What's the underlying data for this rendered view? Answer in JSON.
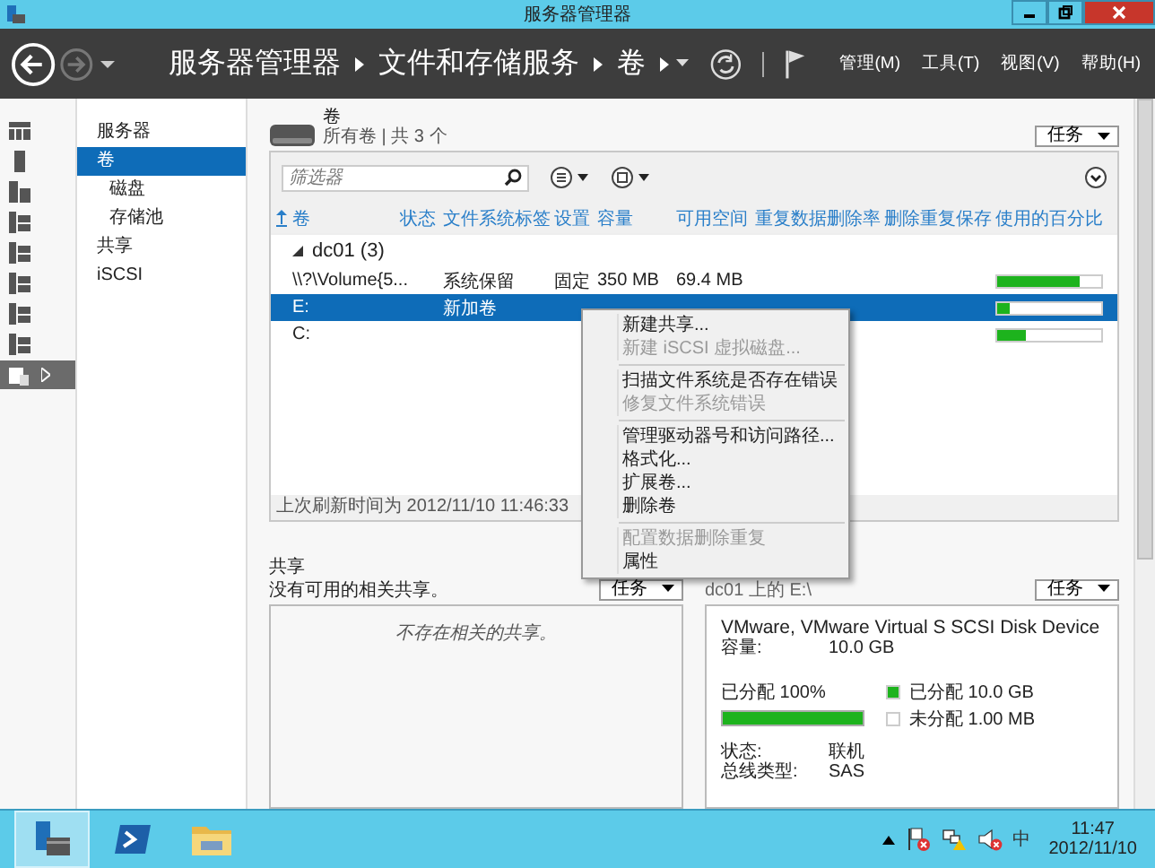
{
  "window": {
    "title": "服务器管理器"
  },
  "nav": {
    "breadcrumb": [
      "服务器管理器",
      "文件和存储服务",
      "卷"
    ],
    "menus": [
      "管理(M)",
      "工具(T)",
      "视图(V)",
      "帮助(H)"
    ]
  },
  "icon_bar": {
    "items": [
      {
        "selected": false
      },
      {
        "selected": false
      },
      {
        "selected": false
      },
      {
        "selected": false
      },
      {
        "selected": false
      },
      {
        "selected": false
      },
      {
        "selected": false
      },
      {
        "selected": false
      },
      {
        "selected": true
      }
    ]
  },
  "sidebar": {
    "items": [
      {
        "label": "服务器",
        "selected": false
      },
      {
        "label": "卷",
        "selected": true,
        "children": [
          {
            "label": "磁盘",
            "selected": false
          },
          {
            "label": "存储池",
            "selected": false
          }
        ]
      },
      {
        "label": "共享",
        "selected": false
      },
      {
        "label": "iSCSI",
        "selected": false
      }
    ]
  },
  "volumes": {
    "title": "卷",
    "subtitle": "所有卷 | 共 3 个",
    "tasks": "任务",
    "filter": {
      "placeholder": "筛选器"
    },
    "columns": [
      "卷",
      "状态",
      "文件系统标签",
      "设置",
      "容量",
      "可用空间",
      "重复数据删除率",
      "删除重复保存",
      "使用的百分比"
    ],
    "group": "dc01 (3)",
    "rows": [
      {
        "name": "\\\\?\\Volume{5...",
        "label": "系统保留",
        "setting": "固定",
        "capacity": "350 MB",
        "free": "69.4 MB",
        "level": 0.8,
        "selected": false
      },
      {
        "name": "E:",
        "label": "新加卷",
        "level": 0.12,
        "selected": true
      },
      {
        "name": "C:",
        "level": 0.28,
        "selected": false
      }
    ],
    "status": "上次刷新时间为 2012/11/10 11:46:33"
  },
  "context_menu": {
    "groups": [
      [
        {
          "label": "新建共享...",
          "disabled": false
        },
        {
          "label": "新建 iSCSI 虚拟磁盘...",
          "disabled": true
        }
      ],
      [
        {
          "label": "扫描文件系统是否存在错误",
          "disabled": false
        },
        {
          "label": "修复文件系统错误",
          "disabled": true
        }
      ],
      [
        {
          "label": "管理驱动器号和访问路径...",
          "disabled": false
        },
        {
          "label": "格式化...",
          "disabled": false
        },
        {
          "label": "扩展卷...",
          "disabled": false
        },
        {
          "label": "删除卷",
          "disabled": false
        }
      ],
      [
        {
          "label": "配置数据删除重复",
          "disabled": true
        },
        {
          "label": "属性",
          "disabled": false
        }
      ]
    ]
  },
  "shares": {
    "title": "共享",
    "subtitle": "没有可用的相关共享。",
    "tasks": "任务",
    "empty": "不存在相关的共享。"
  },
  "disk": {
    "heading": "dc01 上的 E:\\",
    "tasks": "任务",
    "name": "VMware, VMware Virtual S SCSI Disk Device",
    "capacity": {
      "label": "容量:",
      "value": "10.0 GB"
    },
    "allocated_label": "已分配 100%",
    "level": 1,
    "legend": [
      {
        "label": "已分配 10.0 GB",
        "color": "#1db31d"
      },
      {
        "label": "未分配 1.00 MB",
        "color": "#ffffff"
      }
    ],
    "details": [
      {
        "label": "状态:",
        "value": "联机"
      },
      {
        "label": "总线类型:",
        "value": "SAS"
      }
    ]
  },
  "taskbar": {
    "apps": [
      {
        "selected": true
      },
      {
        "selected": false
      },
      {
        "selected": false
      }
    ],
    "ime": "中",
    "time": "11:47",
    "date": "2012/11/10"
  }
}
